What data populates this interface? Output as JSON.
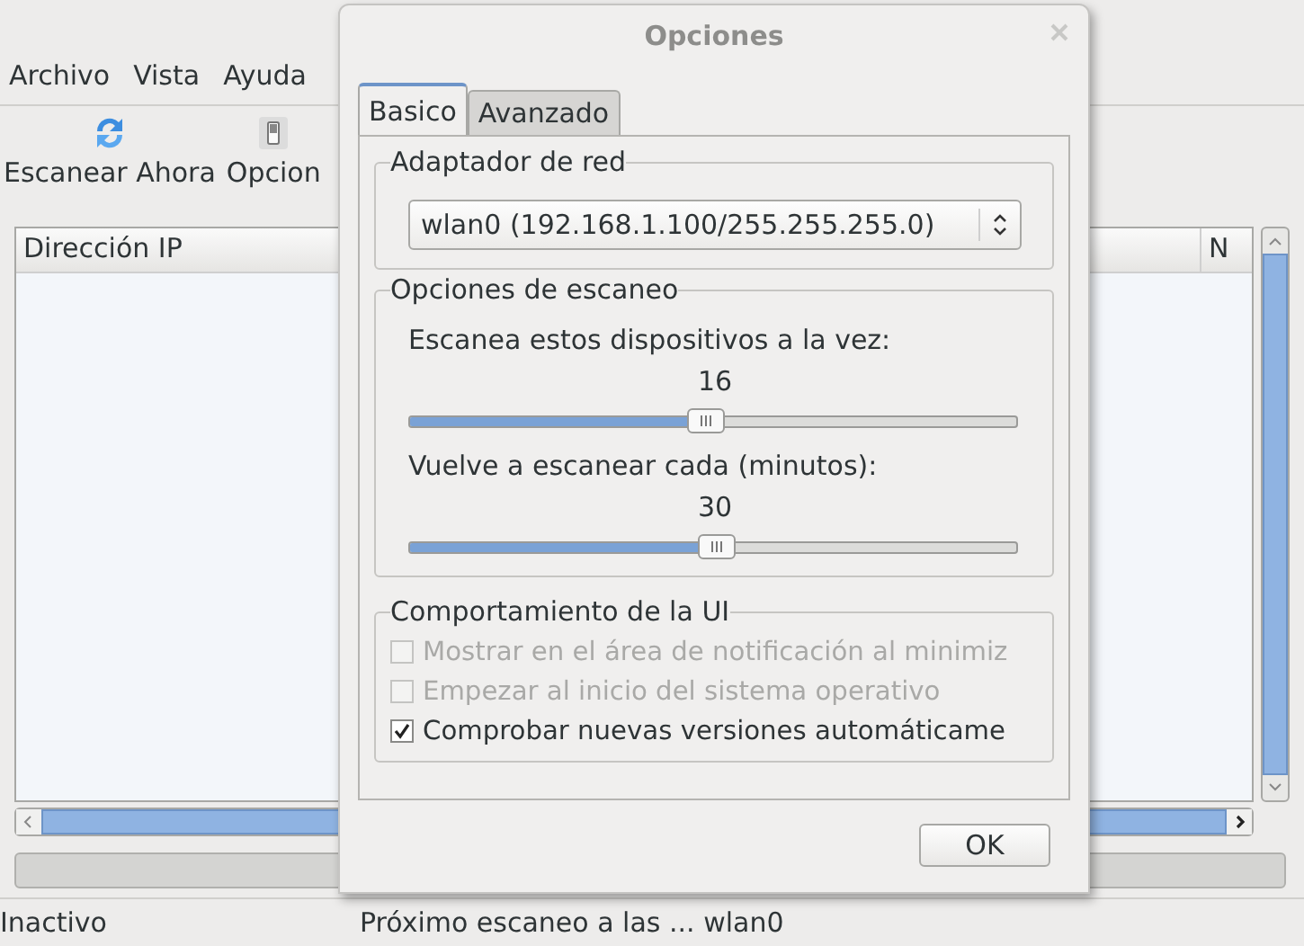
{
  "menu": [
    "Archivo",
    "Vista",
    "Ayuda"
  ],
  "toolbar": [
    {
      "label": "Escanear Ahora",
      "kind": "refresh"
    },
    {
      "label": "Opcion",
      "kind": "switch"
    }
  ],
  "table": {
    "columns": [
      "Dirección IP",
      "N"
    ]
  },
  "status_bar": [
    "Inactivo",
    "Próximo escaneo a las ... wlan0"
  ],
  "dialog": {
    "title": "Opciones",
    "tabs": [
      {
        "label": "Basico",
        "selected": true
      },
      {
        "label": "Avanzado",
        "selected": false
      }
    ],
    "adapter_group": {
      "title": "Adaptador de red",
      "value": "wlan0 (192.168.1.100/255.255.255.0)"
    },
    "scan_group": {
      "title": "Opciones de escaneo",
      "sliders": [
        {
          "label": "Escanea estos dispositivos a la vez:",
          "reading": "16",
          "level": 0.485
        },
        {
          "label": "Vuelve a escanear cada (minutos):",
          "reading": "30",
          "level": 0.5
        }
      ]
    },
    "ui_group": {
      "title": "Comportamiento de la UI",
      "checkboxes": [
        {
          "label": "Mostrar en el área de notificación al minimiz",
          "checked": false,
          "disabled": true
        },
        {
          "label": "Empezar al inicio del sistema operativo",
          "checked": false,
          "disabled": true
        },
        {
          "label": "Comprobar nuevas versiones automáticame",
          "checked": true,
          "disabled": false
        }
      ]
    },
    "buttons": [
      "OK"
    ]
  }
}
